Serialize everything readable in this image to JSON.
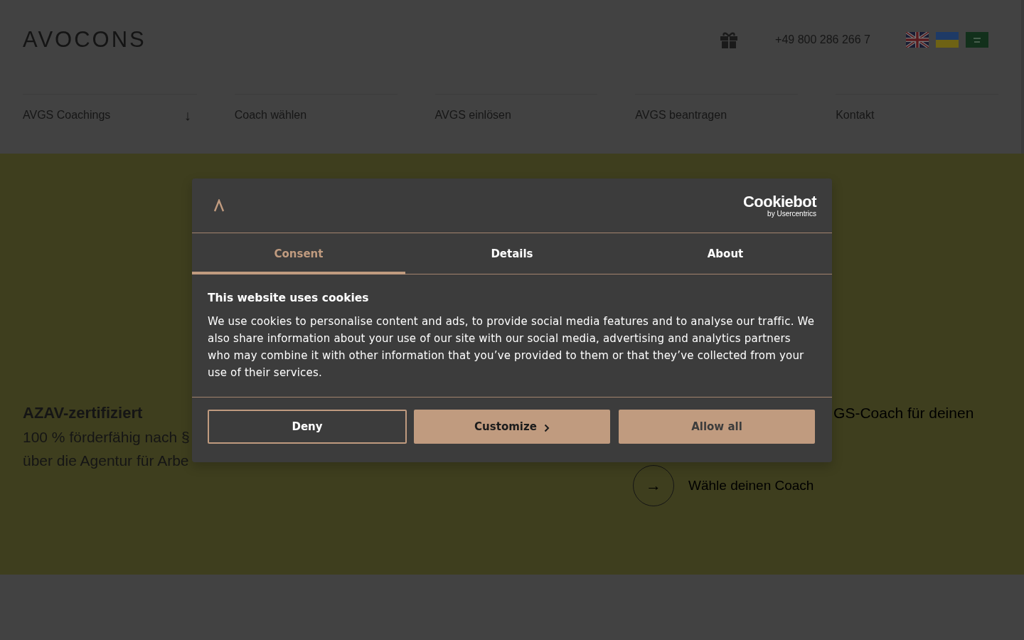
{
  "header": {
    "logo": "AVOCONS",
    "phone": "+49 800 286 266 7",
    "nav": [
      {
        "label": "AVGS Coachings",
        "arrow": "↓"
      },
      {
        "label": "Coach wählen"
      },
      {
        "label": "AVGS einlösen"
      },
      {
        "label": "AVGS beantragen"
      },
      {
        "label": "Kontakt"
      }
    ]
  },
  "hero": {
    "left": {
      "title": "AZAV-zertifiziert",
      "lines": [
        "100 % förderfähig nach §",
        "über die Agentur für Arbe"
      ]
    },
    "right": {
      "lines": [
        "GS-Coach für deinen"
      ]
    },
    "cta": {
      "icon": "→",
      "label": "Wähle deinen Coach"
    }
  },
  "cookie_dialog": {
    "brand": {
      "name": "Cookiebot",
      "sub": "by Usercentrics"
    },
    "tabs": [
      {
        "label": "Consent",
        "selected": true
      },
      {
        "label": "Details",
        "selected": false
      },
      {
        "label": "About",
        "selected": false
      }
    ],
    "title": "This website uses cookies",
    "body": "We use cookies to personalise content and ads, to provide social media features and to analyse our traffic. We also share information about your use of our site with our social media, advertising and analytics partners who may combine it with other information that you’ve provided to them or that they’ve collected from your use of their services.",
    "buttons": [
      {
        "label": "Deny",
        "kind": "outline"
      },
      {
        "label": "Customize",
        "kind": "secondary"
      },
      {
        "label": "Allow all",
        "kind": "primary"
      }
    ]
  }
}
